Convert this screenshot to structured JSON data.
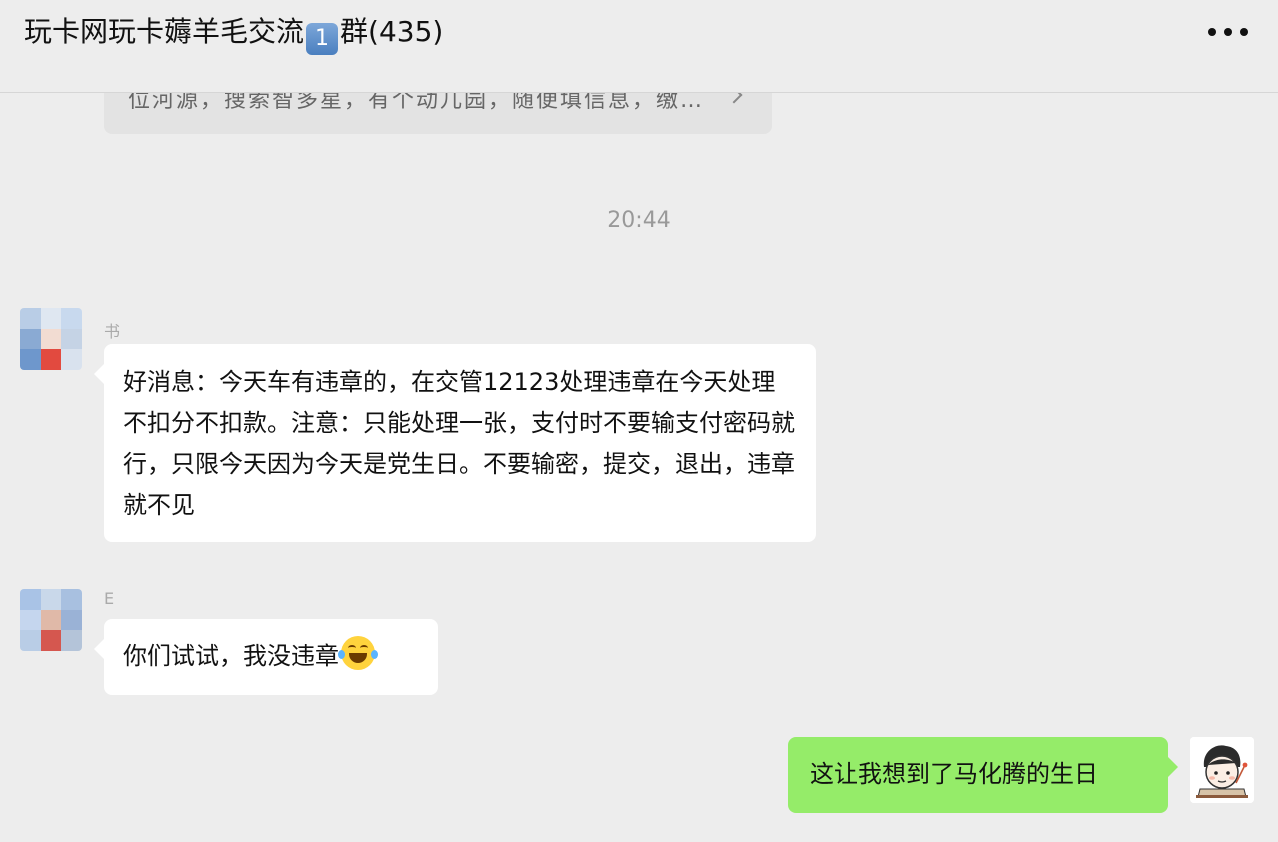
{
  "header": {
    "title_prefix": "玩卡网玩卡薅羊毛交流",
    "badge": "1",
    "title_suffix": "群(435)",
    "more_icon": "more-dots-icon"
  },
  "card": {
    "text": "位河源，搜索智多星，有个动儿园，随便填信息，缴…"
  },
  "timestamp": "20:44",
  "messages": [
    {
      "sender": "书",
      "text": "好消息：今天车有违章的，在交管12123处理违章在今天处理不扣分不扣款。注意：只能处理一张，支付时不要输支付密码就行，只限今天因为今天是党生日。不要输密，提交，退出，违章就不见"
    },
    {
      "sender": "E",
      "text": "你们试试，我没违章",
      "emoji": "face-with-tears-of-joy"
    },
    {
      "sender": "me",
      "text": "这让我想到了马化腾的生日"
    }
  ],
  "colors": {
    "background": "#ededed",
    "incoming_bubble": "#ffffff",
    "outgoing_bubble": "#95ec69"
  }
}
